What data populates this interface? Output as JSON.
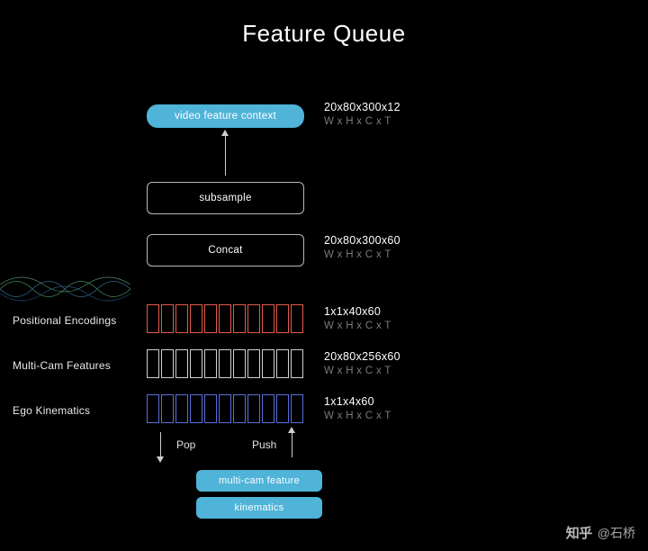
{
  "title": "Feature Queue",
  "nodes": {
    "video_ctx": "video feature context",
    "subsample": "subsample",
    "concat": "Concat",
    "multicam_feat": "multi-cam feature",
    "kinematics": "kinematics"
  },
  "dims": {
    "video_ctx": {
      "shape": "20x80x300x12",
      "axes": "W x H x C x T"
    },
    "concat": {
      "shape": "20x80x300x60",
      "axes": "W x H x C x T"
    },
    "pos_enc": {
      "shape": "1x1x40x60",
      "axes": "W x H x C x T"
    },
    "multicam": {
      "shape": "20x80x256x60",
      "axes": "W x H x C x T"
    },
    "ego": {
      "shape": "1x1x4x60",
      "axes": "W x H x C x T"
    }
  },
  "rows": {
    "pos_enc": "Positional Encodings",
    "multicam": "Multi-Cam Features",
    "ego": "Ego Kinematics"
  },
  "actions": {
    "pop": "Pop",
    "push": "Push"
  },
  "credit": {
    "platform": "知乎",
    "author": "@石桥"
  }
}
